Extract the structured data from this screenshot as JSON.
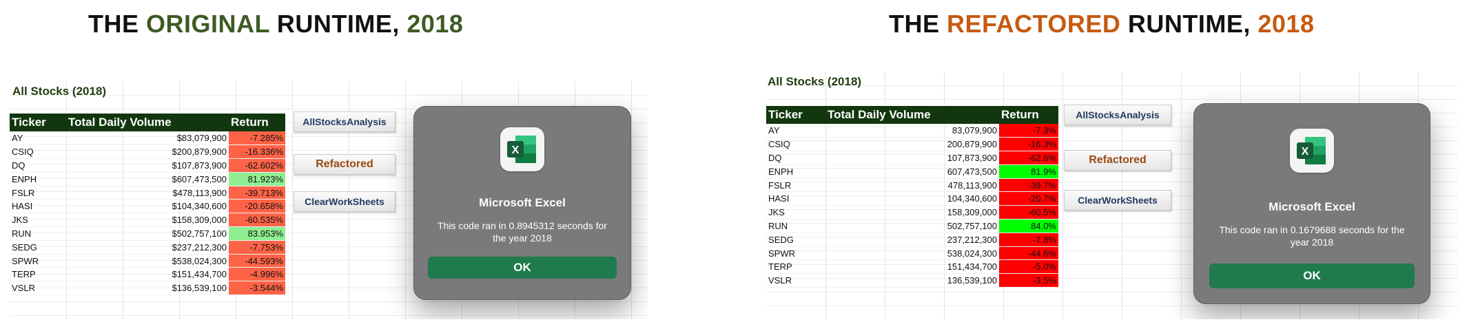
{
  "colors": {
    "green_accent": "#3e5b23",
    "orange_accent": "#c55a11",
    "header_bg": "#12370e",
    "negative_soft": "#ff6347",
    "positive_soft": "#90ee90",
    "negative_strong": "#ff0000",
    "positive_strong": "#00ff00",
    "ok_button": "#1f7a4c"
  },
  "titles": {
    "left": {
      "prefix": "THE ",
      "highlight": "ORIGINAL",
      "middle": " RUNTIME, ",
      "year": "2018"
    },
    "right": {
      "prefix": "THE ",
      "highlight": "REFACTORED",
      "middle": " RUNTIME, ",
      "year": "2018"
    }
  },
  "left": {
    "sheet_title": "All Stocks (2018)",
    "headers": [
      "Ticker",
      "Total Daily Volume",
      "Return"
    ],
    "rows": [
      {
        "ticker": "AY",
        "volume": "$83,079,900",
        "ret": "-7.285%",
        "positive": false
      },
      {
        "ticker": "CSIQ",
        "volume": "$200,879,900",
        "ret": "-16.336%",
        "positive": false
      },
      {
        "ticker": "DQ",
        "volume": "$107,873,900",
        "ret": "-62.602%",
        "positive": false
      },
      {
        "ticker": "ENPH",
        "volume": "$607,473,500",
        "ret": "81.923%",
        "positive": true
      },
      {
        "ticker": "FSLR",
        "volume": "$478,113,900",
        "ret": "-39.713%",
        "positive": false
      },
      {
        "ticker": "HASI",
        "volume": "$104,340,600",
        "ret": "-20.658%",
        "positive": false
      },
      {
        "ticker": "JKS",
        "volume": "$158,309,000",
        "ret": "-60.535%",
        "positive": false
      },
      {
        "ticker": "RUN",
        "volume": "$502,757,100",
        "ret": "83.953%",
        "positive": true
      },
      {
        "ticker": "SEDG",
        "volume": "$237,212,300",
        "ret": "-7.753%",
        "positive": false
      },
      {
        "ticker": "SPWR",
        "volume": "$538,024,300",
        "ret": "-44.593%",
        "positive": false
      },
      {
        "ticker": "TERP",
        "volume": "$151,434,700",
        "ret": "-4.996%",
        "positive": false
      },
      {
        "ticker": "VSLR",
        "volume": "$136,539,100",
        "ret": "-3.544%",
        "positive": false
      }
    ],
    "buttons": {
      "analysis": "AllStocksAnalysis",
      "refactored": "Refactored",
      "clear": "ClearWorkSheets"
    },
    "dialog": {
      "app_name": "Microsoft Excel",
      "message": "This code ran in 0.8945312 seconds for the year 2018",
      "ok": "OK"
    }
  },
  "right": {
    "sheet_title": "All Stocks (2018)",
    "headers": [
      "Ticker",
      "Total Daily Volume",
      "Return"
    ],
    "rows": [
      {
        "ticker": "AY",
        "volume": "83,079,900",
        "ret": "-7.3%",
        "positive": false
      },
      {
        "ticker": "CSIQ",
        "volume": "200,879,900",
        "ret": "-16.3%",
        "positive": false
      },
      {
        "ticker": "DQ",
        "volume": "107,873,900",
        "ret": "-62.6%",
        "positive": false
      },
      {
        "ticker": "ENPH",
        "volume": "607,473,500",
        "ret": "81.9%",
        "positive": true
      },
      {
        "ticker": "FSLR",
        "volume": "478,113,900",
        "ret": "-39.7%",
        "positive": false
      },
      {
        "ticker": "HASI",
        "volume": "104,340,600",
        "ret": "-20.7%",
        "positive": false
      },
      {
        "ticker": "JKS",
        "volume": "158,309,000",
        "ret": "-60.5%",
        "positive": false
      },
      {
        "ticker": "RUN",
        "volume": "502,757,100",
        "ret": "84.0%",
        "positive": true
      },
      {
        "ticker": "SEDG",
        "volume": "237,212,300",
        "ret": "-7.8%",
        "positive": false
      },
      {
        "ticker": "SPWR",
        "volume": "538,024,300",
        "ret": "-44.6%",
        "positive": false
      },
      {
        "ticker": "TERP",
        "volume": "151,434,700",
        "ret": "-5.0%",
        "positive": false
      },
      {
        "ticker": "VSLR",
        "volume": "136,539,100",
        "ret": "-3.5%",
        "positive": false
      }
    ],
    "buttons": {
      "analysis": "AllStocksAnalysis",
      "refactored": "Refactored",
      "clear": "ClearWorkSheets"
    },
    "dialog": {
      "app_name": "Microsoft Excel",
      "message": "This code ran in 0.1679688 seconds for the year 2018",
      "ok": "OK"
    }
  }
}
